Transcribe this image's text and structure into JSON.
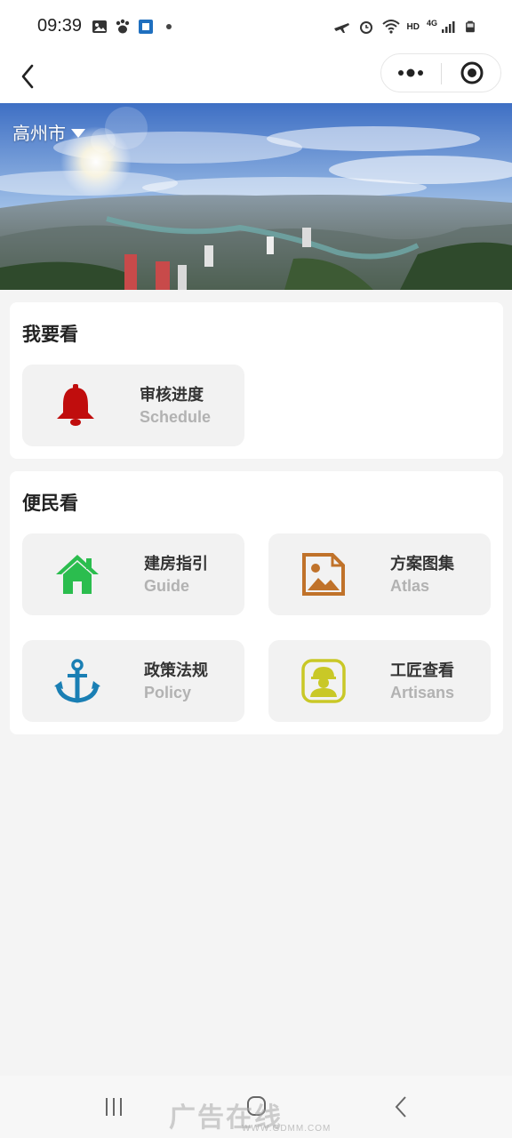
{
  "status_bar": {
    "time": "09:39",
    "left_icons": [
      "image-icon",
      "paw-icon",
      "app-icon",
      "dot-icon"
    ],
    "right_icons": [
      "flight-icon",
      "alarm-icon",
      "wifi-icon",
      "signal-icon",
      "battery-icon"
    ],
    "hd_label": "HD",
    "network_label": "4G"
  },
  "nav": {
    "back_icon": "chevron-left-icon",
    "more_icon": "more-dots-icon",
    "target_icon": "target-icon"
  },
  "banner": {
    "city": "高州市",
    "city_caret_icon": "caret-down-icon"
  },
  "section_watch": {
    "title": "我要看",
    "tiles": [
      {
        "title": "审核进度",
        "subtitle": "Schedule",
        "icon": "bell-icon",
        "color": "#c00d0d"
      }
    ]
  },
  "section_public": {
    "title": "便民看",
    "tiles": [
      {
        "title": "建房指引",
        "subtitle": "Guide",
        "icon": "house-icon",
        "color": "#2bbd4e"
      },
      {
        "title": "方案图集",
        "subtitle": "Atlas",
        "icon": "picture-icon",
        "color": "#c0722a"
      },
      {
        "title": "政策法规",
        "subtitle": "Policy",
        "icon": "anchor-icon",
        "color": "#1a7fb4"
      },
      {
        "title": "工匠查看",
        "subtitle": "Artisans",
        "icon": "worker-icon",
        "color": "#c9c827"
      }
    ]
  },
  "system_nav": {
    "recent_icon": "recent-apps-icon",
    "home_icon": "home-pill-icon",
    "back_icon": "system-back-icon"
  },
  "watermark": {
    "text": "广告在线",
    "url": "WWW.GDMM.COM"
  }
}
